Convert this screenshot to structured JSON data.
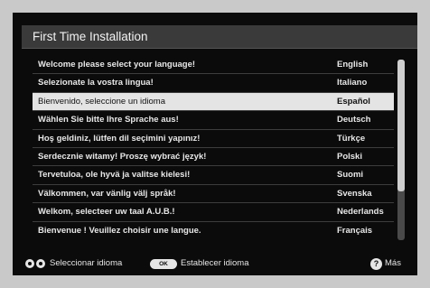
{
  "header": {
    "title": "First Time Installation"
  },
  "languages": [
    {
      "message": "Welcome please select your language!",
      "language": "English"
    },
    {
      "message": "Selezionate la vostra lingua!",
      "language": "Italiano"
    },
    {
      "message": "Bienvenido, seleccione un idioma",
      "language": "Español"
    },
    {
      "message": "Wählen Sie bitte Ihre Sprache aus!",
      "language": "Deutsch"
    },
    {
      "message": "Hoş geldiniz, lütfen dil seçimini yapınız!",
      "language": "Türkçe"
    },
    {
      "message": "Serdecznie witamy! Proszę wybrać język!",
      "language": "Polski"
    },
    {
      "message": "Tervetuloa, ole hyvä ja valitse kielesi!",
      "language": "Suomi"
    },
    {
      "message": "Välkommen, var vänlig välj språk!",
      "language": "Svenska"
    },
    {
      "message": "Welkom, selecteer uw taal A.U.B.!",
      "language": "Nederlands"
    },
    {
      "message": "Bienvenue ! Veuillez choisir une langue.",
      "language": "Français"
    }
  ],
  "selected_index": 2,
  "footer": {
    "select_hint": "Seleccionar idioma",
    "ok_key": "OK",
    "confirm_hint": "Establecer idioma",
    "more_key": "?",
    "more_hint": "Más"
  },
  "colors": {
    "background": "#0b0b0b",
    "title_bar": "#3a3a3a",
    "selection": "#e4e4e4",
    "text": "#e8e8e8"
  }
}
